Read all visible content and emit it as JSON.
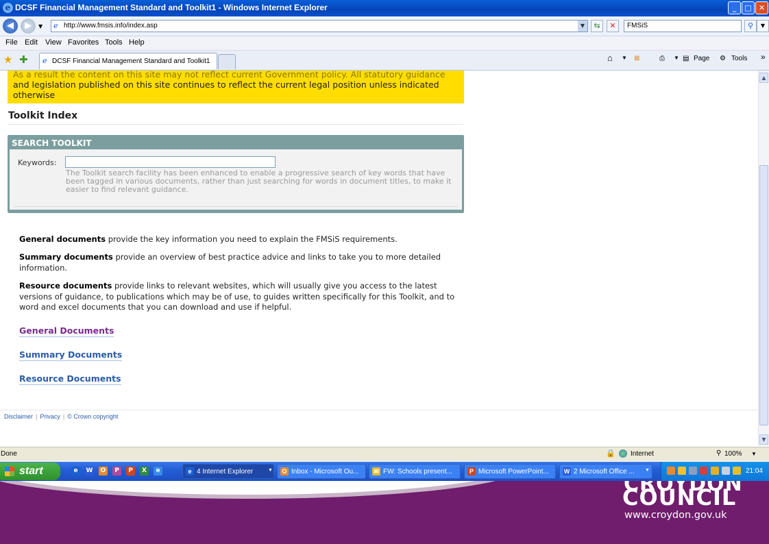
{
  "window": {
    "title": "DCSF Financial Management Standard and Toolkit1 - Windows Internet Explorer",
    "minimize": "_",
    "maximize": "□",
    "close": "✕"
  },
  "address_bar": {
    "url": "http://www.fmsis.info/index.asp",
    "search_value": "FMSiS"
  },
  "menu": [
    "File",
    "Edit",
    "View",
    "Favorites",
    "Tools",
    "Help"
  ],
  "tabs": [
    {
      "label": "DCSF Financial Management Standard and Toolkit1"
    }
  ],
  "command_bar": {
    "page": "Page",
    "tools": "Tools",
    "chevron": "»"
  },
  "page": {
    "notice_cut": "As a result the content on this site may not reflect current Government policy. All statutory guidance",
    "notice": "and legislation published on this site continues to reflect the current legal position unless indicated otherwise",
    "toolkit_title": "Toolkit Index",
    "search": {
      "heading": "SEARCH TOOLKIT",
      "keywords_label": "Keywords:",
      "keywords_value": "",
      "help": "The Toolkit search facility has been enhanced to enable a progressive search of key words that have been tagged in various documents, rather than just searching for words in document titles, to make it easier to find relevant guidance."
    },
    "descriptions": [
      {
        "term": "General documents",
        "text": " provide the key information you need to explain the FMSiS requirements."
      },
      {
        "term": "Summary documents",
        "text": " provide an overview of best practice advice and links to take you to more detailed information."
      },
      {
        "term": "Resource documents",
        "text": " provide links to relevant websites, which will usually give you access to the latest versions of guidance, to publications which may be of use, to guides written specifically for this Toolkit, and to word and excel documents that you can download and use if helpful."
      }
    ],
    "links": [
      "General Documents",
      "Summary Documents",
      "Resource Documents"
    ],
    "footer": [
      "Disclaimer",
      "Privacy",
      "© Crown copyright"
    ]
  },
  "status_bar": {
    "status": "Done",
    "zone": "Internet",
    "zoom": "100%"
  },
  "taskbar": {
    "start": "start",
    "tasks": [
      {
        "label": "4 Internet Explorer",
        "color": "#1a5fd0"
      },
      {
        "label": "Inbox - Microsoft Ou...",
        "color": "#e8892e"
      },
      {
        "label": "FW: Schools present...",
        "color": "#e8b82e"
      },
      {
        "label": "Microsoft PowerPoint...",
        "color": "#d0451b"
      },
      {
        "label": "2 Microsoft Office ...",
        "color": "#2a5bd7"
      }
    ],
    "time": "21:04"
  },
  "branding": {
    "top_word": "CROYDON",
    "council": "COUNCIL",
    "website": "www.croydon.gov.uk"
  },
  "colors": {
    "notice_bg": "#ffdd00",
    "panel": "#7c9e9e",
    "link": "#2b5caa",
    "visited_link": "#7a2a8f",
    "brand": "#6f1d6c"
  }
}
